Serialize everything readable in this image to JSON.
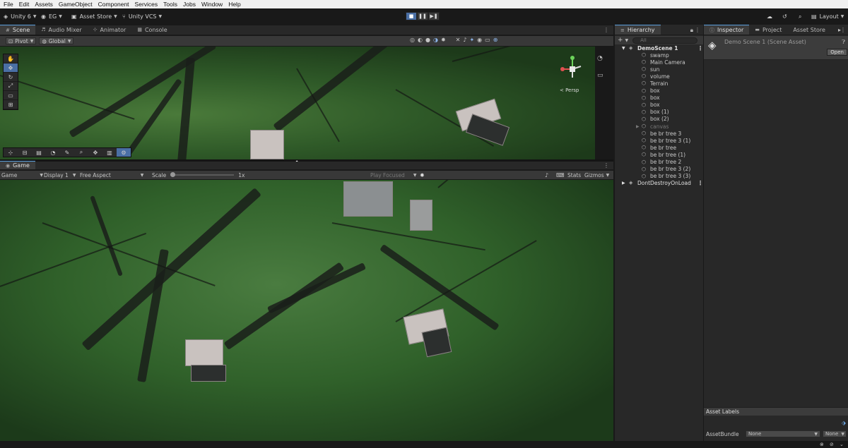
{
  "menu": [
    "File",
    "Edit",
    "Assets",
    "GameObject",
    "Component",
    "Services",
    "Tools",
    "Jobs",
    "Window",
    "Help"
  ],
  "toolbar": {
    "unity_version": "Unity 6",
    "account": "EG",
    "asset_store": "Asset Store",
    "vcs": "Unity VCS",
    "layout": "Layout"
  },
  "scene_tabs": [
    "Scene",
    "Audio Mixer",
    "Animator",
    "Console"
  ],
  "scene_toolbar": {
    "pivot": "Pivot",
    "global": "Global",
    "persp": "< Persp"
  },
  "game": {
    "tab": "Game",
    "mode": "Game",
    "display": "Display 1",
    "aspect": "Free Aspect",
    "scale_label": "Scale",
    "scale_value": "1x",
    "play_focused": "Play Focused",
    "stats": "Stats",
    "gizmos": "Gizmos"
  },
  "hierarchy": {
    "title": "Hierarchy",
    "search_placeholder": "All",
    "scene": "DemoScene 1",
    "items": [
      "swamp",
      "Main Camera",
      "sun",
      "volume",
      "Terrain",
      "box",
      "box",
      "box",
      "box (1)",
      "box (2)",
      "canvas",
      "be br tree 3",
      "be br tree 3 (1)",
      "be br tree",
      "be br tree (1)",
      "be br tree 2",
      "be br tree 3 (2)",
      "be br tree 3 (3)"
    ],
    "dont_destroy": "DontDestroyOnLoad"
  },
  "inspector": {
    "tabs": [
      "Inspector",
      "Project",
      "Asset Store"
    ],
    "asset_name": "Demo Scene 1 (Scene Asset)",
    "open_button": "Open",
    "asset_labels": "Asset Labels",
    "asset_bundle": "AssetBundle",
    "bundle_value": "None",
    "variant_value": "None"
  },
  "colors": {
    "accent": "#4a6fa5",
    "panel": "#282828",
    "background": "#191919"
  }
}
